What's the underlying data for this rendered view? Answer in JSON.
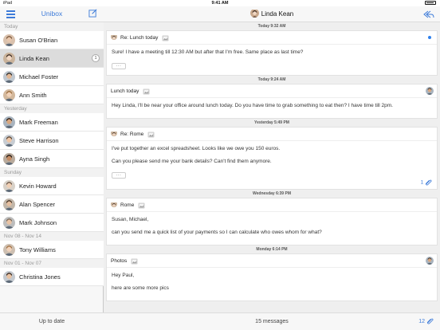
{
  "status": {
    "carrier": "iPad",
    "time": "9:41 AM"
  },
  "sidebar": {
    "title": "Unibox",
    "footer": "Up to date",
    "sections": [
      {
        "label": "Today",
        "contacts": [
          {
            "name": "Susan O'Brian",
            "selected": false
          },
          {
            "name": "Linda Kean",
            "selected": true,
            "badge": "1"
          },
          {
            "name": "Michael Foster",
            "selected": false
          },
          {
            "name": "Ann Smith",
            "selected": false
          }
        ]
      },
      {
        "label": "Yesterday",
        "contacts": [
          {
            "name": "Mark Freeman"
          },
          {
            "name": "Steve Harrison"
          },
          {
            "name": "Ayna Singh"
          }
        ]
      },
      {
        "label": "Sunday",
        "contacts": [
          {
            "name": "Kevin Howard"
          },
          {
            "name": "Alan Spencer"
          },
          {
            "name": "Mark Johnson"
          }
        ]
      },
      {
        "label": "Nov 08 - Nov 14",
        "contacts": [
          {
            "name": "Tony Williams"
          }
        ]
      },
      {
        "label": "Nov 01 - Nov 07",
        "contacts": [
          {
            "name": "Christina Jones"
          }
        ]
      }
    ]
  },
  "main": {
    "header_name": "Linda Kean",
    "footer": "15 messages",
    "footer_count": "12",
    "messages": [
      {
        "date": "Today 9:32 AM",
        "subject": "Re: Lunch today",
        "body": [
          "Sure! I have a meeting till 12:30 AM but after that I'm free. Same place as last time?"
        ],
        "more": true,
        "unread": true
      },
      {
        "date": "Today 9:24 AM",
        "subject": "Lunch today",
        "body": [
          "Hey Linda, I'll be near your office around lunch today. Do you have time to grab something to eat then? I have time till 2pm."
        ],
        "outgoing": true
      },
      {
        "date": "Yesterday 5:49 PM",
        "subject": "Re: Rome",
        "body": [
          "I've put together an excel spreadsheet. Looks like we owe you 150 euros.",
          "Can you please send me your bank details? Can't find them anymore."
        ],
        "more": true,
        "attachments": "1"
      },
      {
        "date": "Wednesday 6:39 PM",
        "subject": "Rome",
        "body": [
          "Susan, Michael,",
          "can you send me a quick list of your payments so I can calculate who owes whom for what?"
        ]
      },
      {
        "date": "Monday 6:14 PM",
        "subject": "Photos",
        "body": [
          "Hey Paul,",
          "here are some more pics"
        ],
        "outgoing": true
      }
    ]
  },
  "colors": {
    "accent": "#3d7bd9",
    "unread": "#2f80ed"
  },
  "icons": {
    "menu": "menu-icon",
    "compose": "compose-icon",
    "reply": "reply-all-icon",
    "attachment": "attachment-icon"
  }
}
